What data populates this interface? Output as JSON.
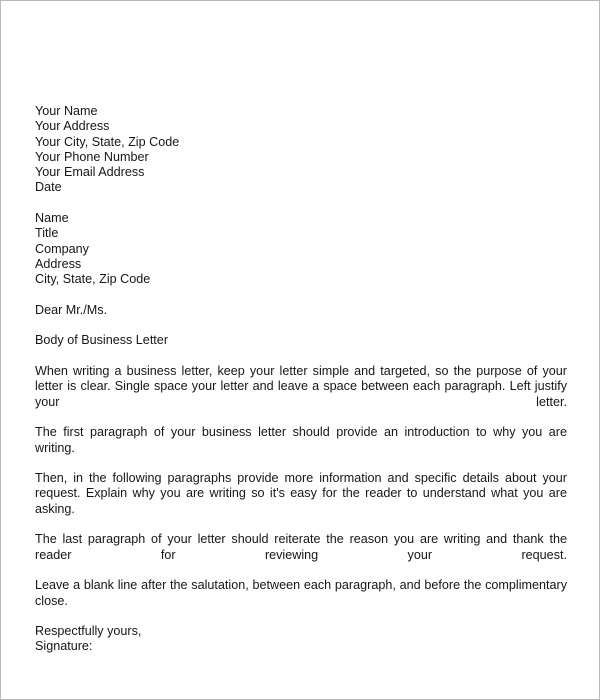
{
  "document": {
    "type": "business-letter-template",
    "text_color": "#161616",
    "page_background": "#ffffff",
    "border_color": "#b9b9b9",
    "sender_block": {
      "lines": [
        "Your Name",
        "Your Address",
        "Your City, State, Zip Code",
        "Your Phone Number",
        "Your Email Address",
        "Date"
      ]
    },
    "recipient_block": {
      "lines": [
        "Name",
        "Title",
        "Company",
        "Address",
        "City, State, Zip Code"
      ]
    },
    "salutation": "Dear Mr./Ms.",
    "body_heading": "Body of Business Letter",
    "body_paragraphs": [
      "When writing a business letter, keep your letter simple and targeted, so the purpose of your letter is clear. Single space your letter and leave a space between each paragraph. Left justify your letter.",
      "The first paragraph of your business letter should provide an introduction to why you are writing.",
      "Then, in the following paragraphs provide more information and specific details about your request. Explain why you are writing so it's easy for the reader to understand what you are asking.",
      "The last paragraph of your letter should reiterate the reason you are writing and thank the reader for reviewing your request.",
      "Leave a blank line after the salutation, between each paragraph, and before the complimentary close."
    ],
    "closing": {
      "complimentary_close": "Respectfully yours,",
      "signature_label": "Signature:"
    }
  }
}
